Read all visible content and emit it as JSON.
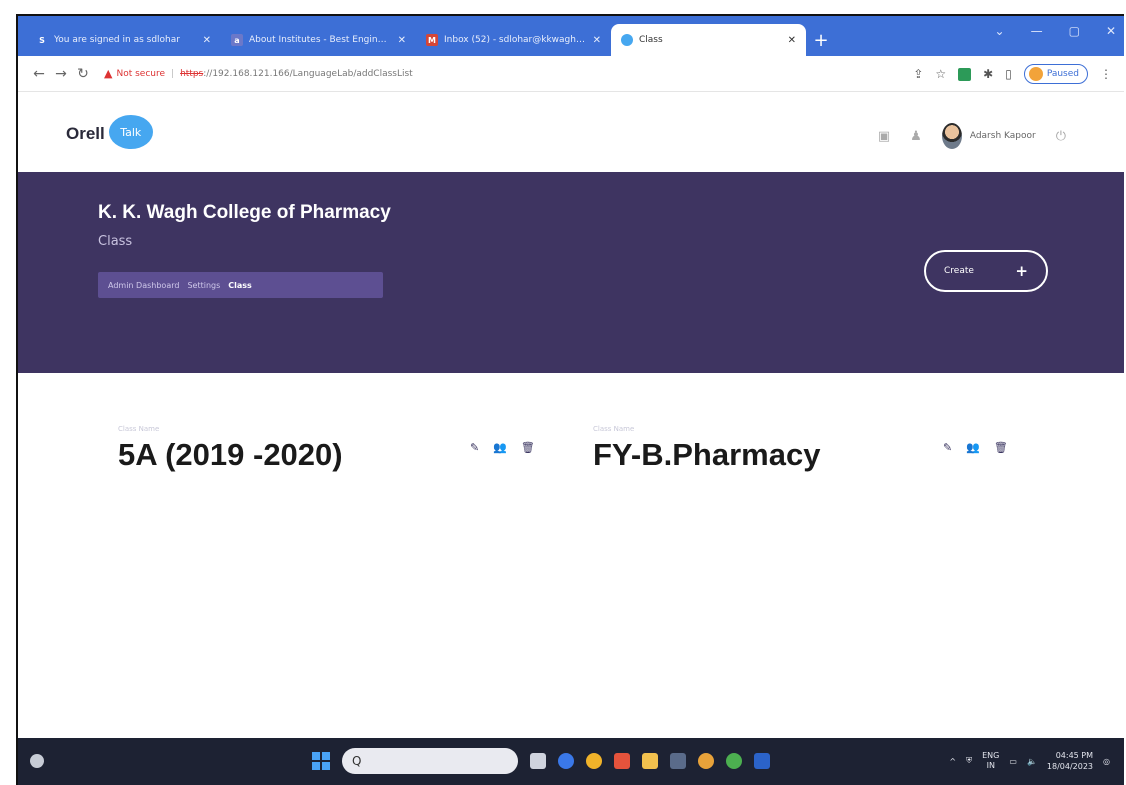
{
  "browser": {
    "tabs": [
      {
        "title": "You are signed in as sdlohar",
        "favicon_letter": "S",
        "favicon_color": "#3d6fd6",
        "active": false
      },
      {
        "title": "About Institutes - Best Engineeri...",
        "favicon_letter": "a",
        "favicon_color": "#6b78c9",
        "active": false
      },
      {
        "title": "Inbox (52) - sdlohar@kkwagh.ed...",
        "favicon_letter": "M",
        "favicon_color": "#d44638",
        "active": false
      },
      {
        "title": "Class",
        "favicon_letter": "",
        "favicon_color": "#46a7f0",
        "active": true
      }
    ],
    "new_tab": "+",
    "window_controls": [
      "⌄",
      "—",
      "▢",
      "✕"
    ],
    "address": {
      "warning": "Not secure",
      "scheme": "https",
      "url_rest": "://192.168.121.166/LanguageLab/addClassList"
    },
    "profile_label": "Paused"
  },
  "app": {
    "logo_text": "Orell",
    "logo_bubble": "Talk",
    "user_name": "Adarsh Kapoor"
  },
  "banner": {
    "college": "K. K. Wagh College of Pharmacy",
    "page": "Class",
    "breadcrumbs": [
      "Admin Dashboard",
      "Settings",
      "Class"
    ],
    "create_label": "Create",
    "create_plus": "+"
  },
  "classes": [
    {
      "label": "Class Name",
      "name": "5A (2019 -2020)"
    },
    {
      "label": "Class Name",
      "name": "FY-B.Pharmacy"
    }
  ],
  "taskbar": {
    "search_placeholder": "Q",
    "lang_top": "ENG",
    "lang_bottom": "IN",
    "time": "04:45 PM",
    "date": "18/04/2023"
  },
  "colors": {
    "banner": "#3e3461",
    "breadcrumb_bg": "#5d4f92",
    "chrome_blue": "#3d6fd6",
    "logo_blue": "#46a7f0"
  }
}
